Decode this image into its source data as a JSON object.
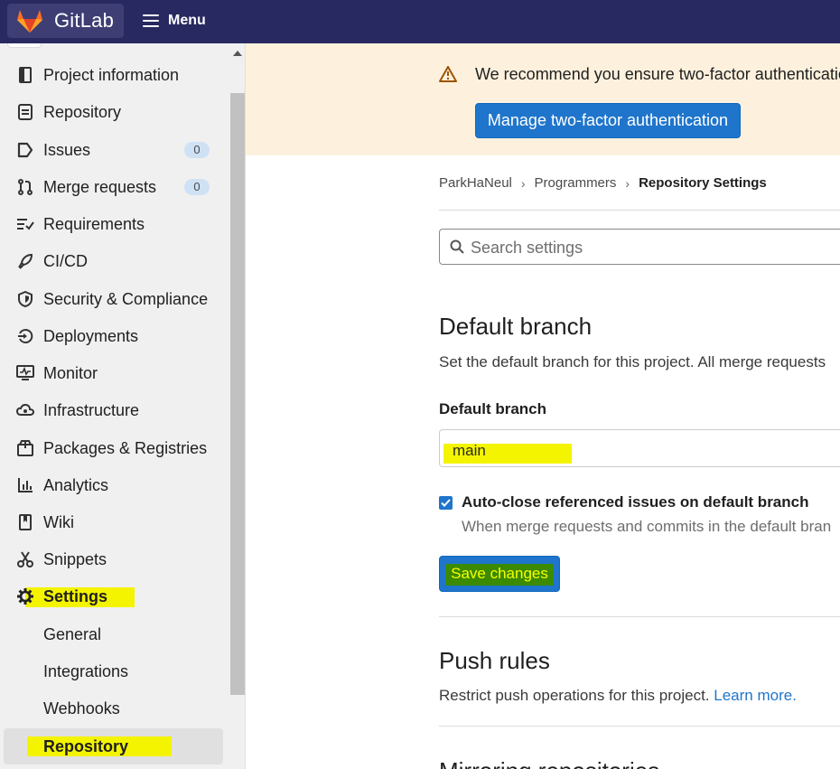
{
  "topbar": {
    "brand": "GitLab",
    "menu_label": "Menu"
  },
  "sidebar": {
    "items": [
      {
        "label": "Project information",
        "icon": "project-info-icon"
      },
      {
        "label": "Repository",
        "icon": "repository-icon"
      },
      {
        "label": "Issues",
        "icon": "issues-icon",
        "count": "0"
      },
      {
        "label": "Merge requests",
        "icon": "merge-request-icon",
        "count": "0"
      },
      {
        "label": "Requirements",
        "icon": "requirements-icon"
      },
      {
        "label": "CI/CD",
        "icon": "rocket-icon"
      },
      {
        "label": "Security & Compliance",
        "icon": "shield-icon"
      },
      {
        "label": "Deployments",
        "icon": "deployments-icon"
      },
      {
        "label": "Monitor",
        "icon": "monitor-icon"
      },
      {
        "label": "Infrastructure",
        "icon": "cloud-icon"
      },
      {
        "label": "Packages & Registries",
        "icon": "package-icon"
      },
      {
        "label": "Analytics",
        "icon": "analytics-icon"
      },
      {
        "label": "Wiki",
        "icon": "book-icon"
      },
      {
        "label": "Snippets",
        "icon": "scissors-icon"
      },
      {
        "label": "Settings",
        "icon": "gear-icon"
      }
    ],
    "settings_sub": [
      "General",
      "Integrations",
      "Webhooks",
      "Repository"
    ]
  },
  "alert": {
    "text": "We recommend you ensure two-factor authentication",
    "button": "Manage two-factor authentication"
  },
  "breadcrumb": {
    "items": [
      "ParkHaNeul",
      "Programmers",
      "Repository Settings"
    ]
  },
  "search": {
    "placeholder": "Search settings"
  },
  "default_branch": {
    "title": "Default branch",
    "description": "Set the default branch for this project. All merge requests",
    "field_label": "Default branch",
    "value": "main",
    "checkbox_label": "Auto-close referenced issues on default branch",
    "checkbox_checked": true,
    "checkbox_help": "When merge requests and commits in the default bran",
    "save_label": "Save changes"
  },
  "push_rules": {
    "title": "Push rules",
    "description": "Restrict push operations for this project.",
    "link": "Learn more."
  },
  "mirroring": {
    "title": "Mirroring repositories"
  },
  "colors": {
    "topbar": "#292961",
    "primary": "#1f75cb",
    "highlight": "#f4f400",
    "alert_bg": "#fdf1dd"
  }
}
